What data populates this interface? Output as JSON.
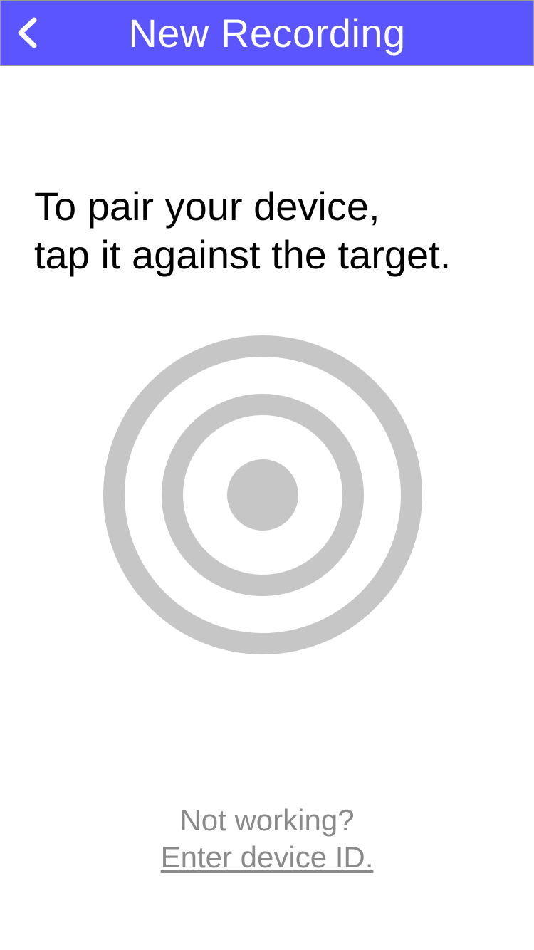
{
  "header": {
    "back_icon": "chevron-left-icon",
    "title": "New Recording",
    "color": "#5a55ff"
  },
  "instruction": {
    "line1": "To pair your device,",
    "line2": "tap it against the target."
  },
  "target": {
    "icon": "target-icon",
    "color": "#c6c6c6"
  },
  "footer": {
    "prompt": "Not working?",
    "link": "Enter device ID.",
    "color": "#8a8a8a"
  }
}
